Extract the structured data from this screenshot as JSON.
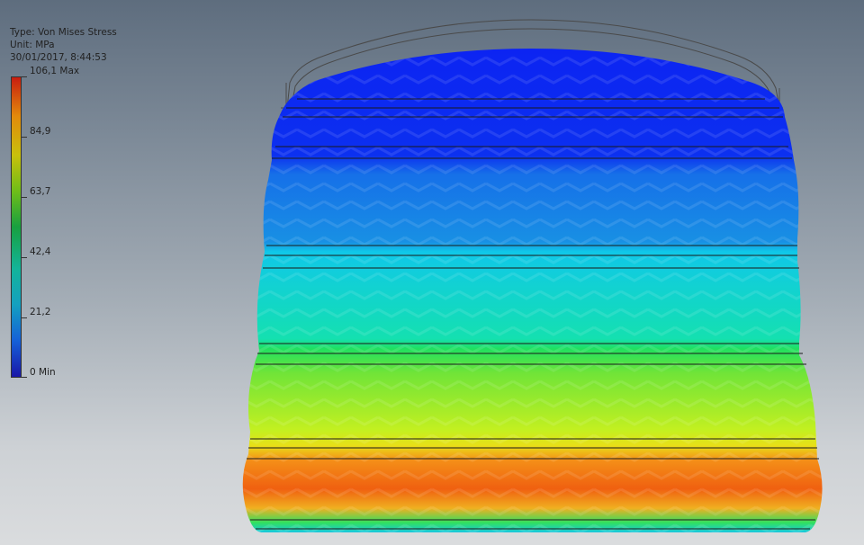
{
  "result_info": {
    "type_line": "Type: Von Mises Stress",
    "unit_line": "Unit: MPa",
    "timestamp": "30/01/2017, 8:44:53"
  },
  "legend": {
    "max_label": "106,1 Max",
    "min_label": "0 Min",
    "ticks": [
      {
        "id": "max",
        "label": "106,1 Max",
        "value": 106.1
      },
      {
        "id": "84-9",
        "label": "84,9",
        "value": 84.9
      },
      {
        "id": "63-7",
        "label": "63,7",
        "value": 63.7
      },
      {
        "id": "42-4",
        "label": "42,4",
        "value": 42.4
      },
      {
        "id": "21-2",
        "label": "21,2",
        "value": 21.2
      },
      {
        "id": "min",
        "label": "0 Min",
        "value": 0
      }
    ],
    "colors": [
      "#1a17a8",
      "#1560d8",
      "#14a0c0",
      "#13b49a",
      "#18a040",
      "#6fbd18",
      "#c9c00c",
      "#e28a0c",
      "#c81d10"
    ]
  },
  "model_colors": {
    "top": "#0a2af0",
    "band_upper": "#1a78e8",
    "band_cyan": "#12d4e0",
    "band_green": "#6ee030",
    "band_yellow": "#c8f020",
    "band_orange": "#f07010",
    "bottom": "#18e060",
    "outline": "#333333"
  }
}
